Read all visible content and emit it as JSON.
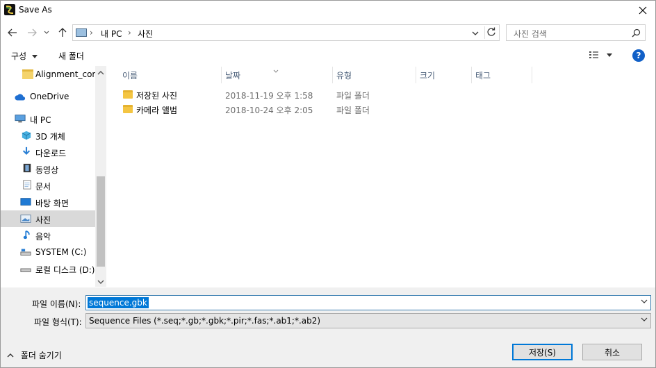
{
  "window": {
    "title": "Save As"
  },
  "address": {
    "crumbs": [
      "내 PC",
      "사진"
    ],
    "search_placeholder": "사진 검색"
  },
  "toolbar": {
    "organize": "구성",
    "new_folder": "새 폴더"
  },
  "nav": {
    "items": [
      {
        "label": "Alignment_com",
        "icon": "folder-icon"
      },
      {
        "label": "OneDrive",
        "icon": "cloud-icon"
      },
      {
        "label": "내 PC",
        "icon": "computer-icon"
      },
      {
        "label": "3D 개체",
        "icon": "cube-3d-icon"
      },
      {
        "label": "다운로드",
        "icon": "download-icon"
      },
      {
        "label": "동영상",
        "icon": "video-icon"
      },
      {
        "label": "문서",
        "icon": "document-icon"
      },
      {
        "label": "바탕 화면",
        "icon": "desktop-icon"
      },
      {
        "label": "사진",
        "icon": "pictures-icon",
        "selected": true
      },
      {
        "label": "음악",
        "icon": "music-icon"
      },
      {
        "label": "SYSTEM (C:)",
        "icon": "drive-icon"
      },
      {
        "label": "로컬 디스크 (D:)",
        "icon": "drive-icon"
      }
    ]
  },
  "columns": {
    "name": "이름",
    "date": "날짜",
    "type": "유형",
    "size": "크기",
    "tags": "태그"
  },
  "files": [
    {
      "name": "저장된 사진",
      "date": "2018-11-19 오후 1:58",
      "type": "파일 폴더"
    },
    {
      "name": "카메라 앨범",
      "date": "2018-10-24 오후 2:05",
      "type": "파일 폴더"
    }
  ],
  "form": {
    "filename_label": "파일 이름(N):",
    "filename_value": "sequence.gbk",
    "filetype_label": "파일 형식(T):",
    "filetype_value": "Sequence Files (*.seq;*.gb;*.gbk;*.pir;*.fas;*.ab1;*.ab2)"
  },
  "footer": {
    "hide_folders": "폴더 숨기기",
    "save": "저장(S)",
    "cancel": "취소"
  },
  "colors": {
    "accent": "#0078d7",
    "selected_row": "#d9d9d9",
    "help": "#1160c7"
  }
}
